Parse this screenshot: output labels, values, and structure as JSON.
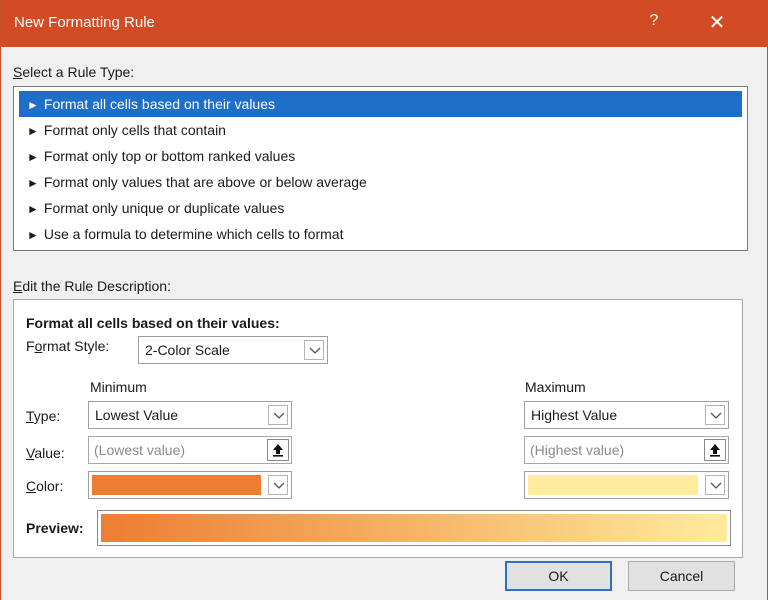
{
  "window": {
    "title": "New Formatting Rule",
    "help_glyph": "?",
    "close_glyph": "✕"
  },
  "rule_type": {
    "label": "Select a Rule Type:",
    "label_underlined_char": "S",
    "label_rest": "elect a Rule Type:",
    "items": [
      {
        "label": "Format all cells based on their values",
        "selected": true
      },
      {
        "label": "Format only cells that contain",
        "selected": false
      },
      {
        "label": "Format only top or bottom ranked values",
        "selected": false
      },
      {
        "label": "Format only values that are above or below average",
        "selected": false
      },
      {
        "label": "Format only unique or duplicate values",
        "selected": false
      },
      {
        "label": "Use a formula to determine which cells to format",
        "selected": false
      }
    ],
    "arrow_glyph": "►"
  },
  "description": {
    "label_underlined_char": "E",
    "label_rest": "dit the Rule Description:",
    "heading": "Format all cells based on their values:",
    "format_style_label_pre": "F",
    "format_style_label_u": "o",
    "format_style_label_post": "rmat Style:",
    "format_style_value": "2-Color Scale",
    "minimum_header": "Minimum",
    "maximum_header": "Maximum",
    "type_label_u": "T",
    "type_label_rest": "ype:",
    "value_label_u": "V",
    "value_label_rest": "alue:",
    "color_label_u": "C",
    "color_label_rest": "olor:",
    "min_type": "Lowest Value",
    "max_type": "Highest Value",
    "min_value_placeholder": "(Lowest value)",
    "max_value_placeholder": "(Highest value)",
    "min_color": "#ed7d31",
    "max_color": "#ffeb9c",
    "preview_label": "Preview:"
  },
  "buttons": {
    "ok": "OK",
    "cancel": "Cancel"
  },
  "colors": {
    "titlebar": "#d24b25",
    "selection": "#1e6fc9"
  }
}
